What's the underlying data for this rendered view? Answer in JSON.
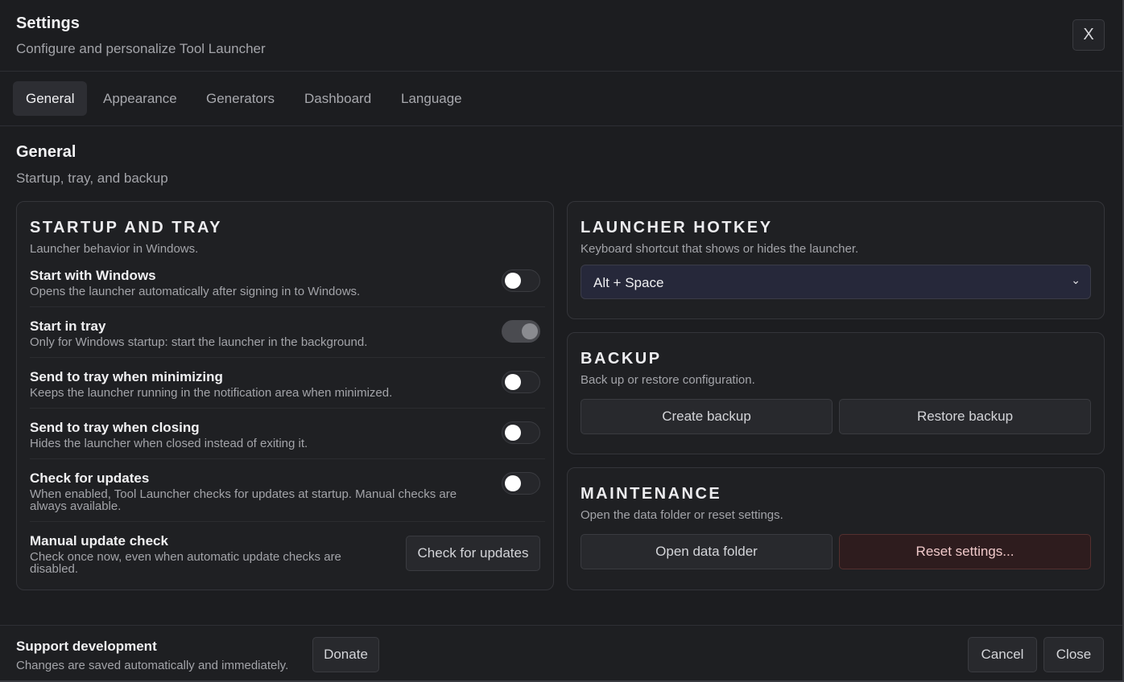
{
  "header": {
    "title": "Settings",
    "subtitle": "Configure and personalize Tool Launcher",
    "close_label": "X"
  },
  "tabs": [
    {
      "label": "General",
      "active": true
    },
    {
      "label": "Appearance",
      "active": false
    },
    {
      "label": "Generators",
      "active": false
    },
    {
      "label": "Dashboard",
      "active": false
    },
    {
      "label": "Language",
      "active": false
    }
  ],
  "section": {
    "title": "General",
    "subtitle": "Startup, tray, and backup"
  },
  "startup": {
    "title": "STARTUP AND TRAY",
    "subtitle": "Launcher behavior in Windows.",
    "rows": [
      {
        "label": "Start with Windows",
        "desc": "Opens the launcher automatically after signing in to Windows.",
        "toggle": "off"
      },
      {
        "label": "Start in tray",
        "desc": "Only for Windows startup: start the launcher in the background.",
        "toggle": "disabled-on"
      },
      {
        "label": "Send to tray when minimizing",
        "desc": "Keeps the launcher running in the notification area when minimized.",
        "toggle": "off"
      },
      {
        "label": "Send to tray when closing",
        "desc": "Hides the launcher when closed instead of exiting it.",
        "toggle": "off"
      },
      {
        "label": "Check for updates",
        "desc": "When enabled, Tool Launcher checks for updates at startup. Manual checks are always available.",
        "toggle": "off"
      },
      {
        "label": "Manual update check",
        "desc": "Check once now, even when automatic update checks are disabled.",
        "button": "Check for updates"
      }
    ]
  },
  "hotkey": {
    "title": "LAUNCHER HOTKEY",
    "subtitle": "Keyboard shortcut that shows or hides the launcher.",
    "selected": "Alt + Space"
  },
  "backup": {
    "title": "BACKUP",
    "subtitle": "Back up or restore configuration.",
    "create_label": "Create backup",
    "restore_label": "Restore backup"
  },
  "maintenance": {
    "title": "MAINTENANCE",
    "subtitle": "Open the data folder or reset settings.",
    "open_label": "Open data folder",
    "reset_label": "Reset settings..."
  },
  "footer": {
    "title": "Support development",
    "subtitle": "Changes are saved automatically and immediately.",
    "donate_label": "Donate",
    "cancel_label": "Cancel",
    "close_label": "Close"
  },
  "colors": {
    "background": "#1c1d20",
    "card": "#1f2023",
    "select_bg": "#26283a",
    "danger_bg": "#2e1c1e"
  }
}
